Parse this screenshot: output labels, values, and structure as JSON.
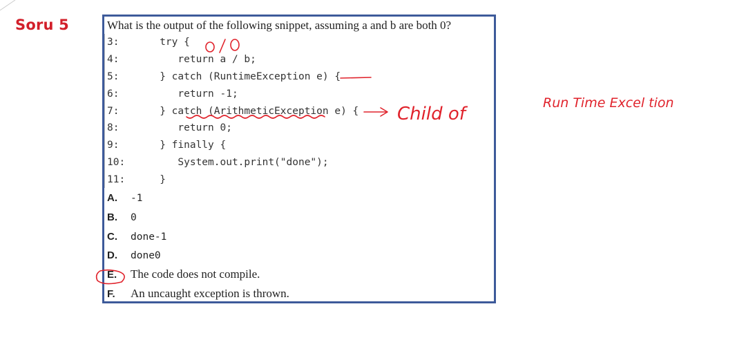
{
  "section_label": "Soru 5",
  "question": "What is the output of the following snippet, assuming a and b are both 0?",
  "code_lines": [
    {
      "num": "3:",
      "code": "   try {"
    },
    {
      "num": "4:",
      "code": "      return a / b;"
    },
    {
      "num": "5:",
      "code": "   } catch (RuntimeException e) {"
    },
    {
      "num": "6:",
      "code": "      return -1;"
    },
    {
      "num": "7:",
      "code": "   } catch (ArithmeticException e) {"
    },
    {
      "num": "8:",
      "code": "      return 0;"
    },
    {
      "num": "9:",
      "code": "   } finally {"
    },
    {
      "num": "10:",
      "code": "      System.out.print(\"done\");"
    },
    {
      "num": "11:",
      "code": "   }"
    }
  ],
  "options": [
    {
      "letter": "A.",
      "text": "-1"
    },
    {
      "letter": "B.",
      "text": "0"
    },
    {
      "letter": "C.",
      "text": "done-1"
    },
    {
      "letter": "D.",
      "text": "done0"
    },
    {
      "letter": "E.",
      "text": "The code does not compile."
    },
    {
      "letter": "F.",
      "text": "An uncaught exception is thrown."
    }
  ],
  "annotations": {
    "zero_over_zero": "0/0",
    "child_of": "Child of",
    "runtime_exception": "Run Time Excel tion"
  },
  "colors": {
    "accent": "#d21f2a",
    "border": "#3d5a9a",
    "ink": "#e0222b"
  }
}
